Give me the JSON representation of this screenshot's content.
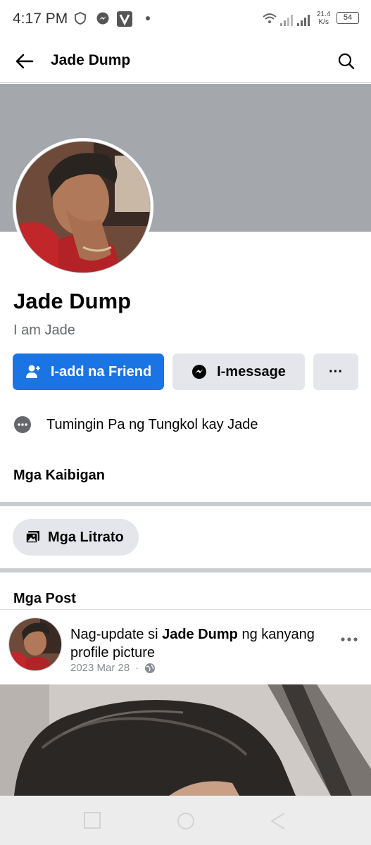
{
  "status_bar": {
    "time": "4:17 PM",
    "speed_value": "21.4",
    "speed_unit": "K/s",
    "battery": "54"
  },
  "app_bar": {
    "title": "Jade Dump",
    "back_icon": "arrow-left-icon",
    "search_icon": "search-icon"
  },
  "profile": {
    "name": "Jade Dump",
    "bio": "I am Jade",
    "add_friend_label": "I-add na Friend",
    "message_label": "I-message",
    "more_label": "···",
    "about_link": "Tumingin Pa ng Tungkol kay Jade"
  },
  "sections": {
    "friends_title": "Mga Kaibigan",
    "photos_label": "Mga Litrato",
    "posts_title": "Mga Post"
  },
  "post": {
    "headline_prefix": "Nag-update si ",
    "headline_name": "Jade Dump",
    "headline_suffix": " ng kanyang profile picture",
    "date": "2023 Mar 28",
    "separator": "·",
    "privacy_icon": "globe-icon"
  },
  "colors": {
    "primary": "#1b74e4",
    "secondary_button": "#e4e6eb",
    "cover": "#a4a8ad",
    "muted_text": "#65676b"
  }
}
